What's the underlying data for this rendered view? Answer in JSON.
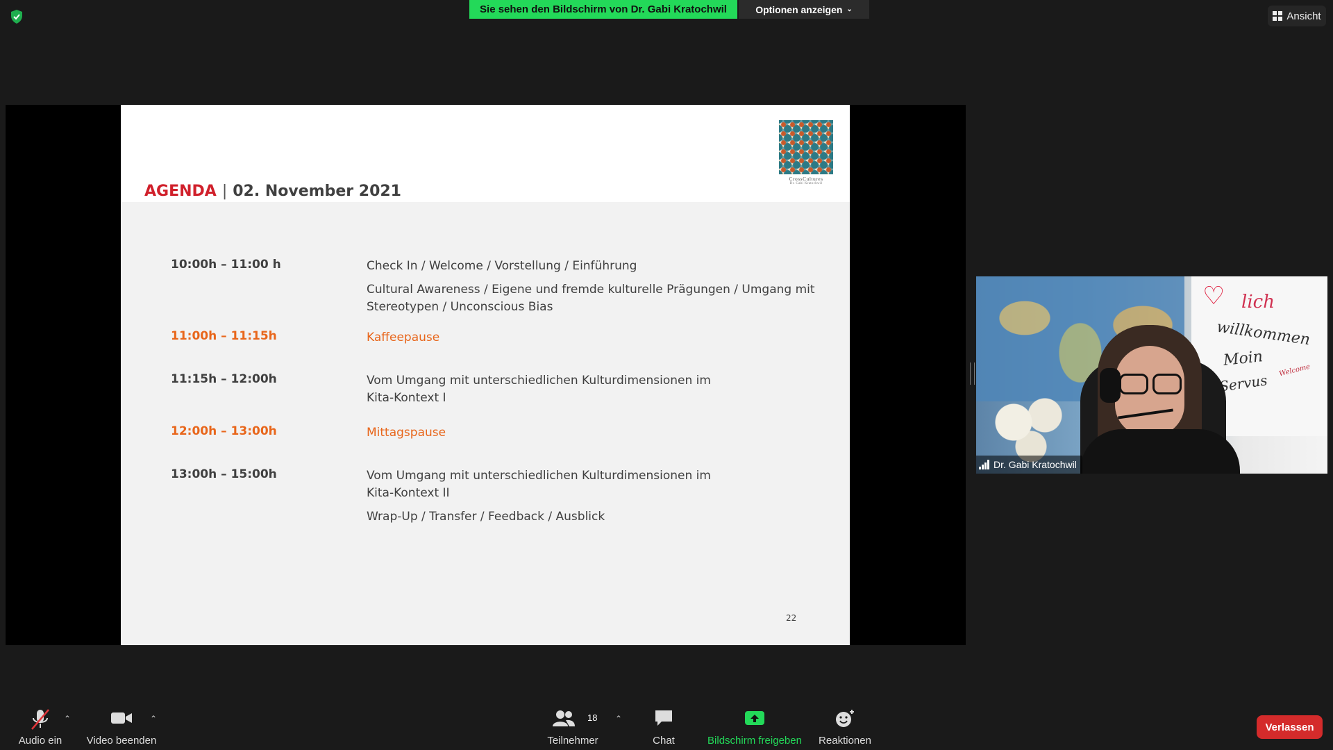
{
  "top_bar": {
    "share_banner": "Sie sehen den Bildschirm von Dr. Gabi Kratochwil",
    "options_label": "Optionen anzeigen",
    "view_label": "Ansicht"
  },
  "slide": {
    "title_accent": "AGENDA",
    "title_separator": "|",
    "title_date": "02. November 2021",
    "logo_line1": "CrossCultures",
    "logo_line2": "Dr. Gabi Kratochwil",
    "page_number": "22",
    "agenda": [
      {
        "time": "10:00h – 11:00 h",
        "items": [
          "Check In / Welcome / Vorstellung / Einführung",
          "Cultural Awareness / Eigene und fremde kulturelle Prägungen / Umgang mit Stereotypen / Unconscious Bias"
        ],
        "highlight": false
      },
      {
        "time": "11:00h – 11:15h",
        "items": [
          "Kaffeepause"
        ],
        "highlight": true
      },
      {
        "time": "11:15h – 12:00h",
        "items": [
          "Vom Umgang mit unterschiedlichen Kulturdimensionen im Kita-Kontext I"
        ],
        "highlight": false
      },
      {
        "time": "12:00h – 13:00h",
        "items": [
          "Mittagspause"
        ],
        "highlight": true
      },
      {
        "time": "13:00h – 15:00h",
        "items": [
          "Vom Umgang mit unterschiedlichen Kulturdimensionen im Kita-Kontext II",
          "Wrap-Up / Transfer / Feedback / Ausblick"
        ],
        "highlight": false
      }
    ]
  },
  "video": {
    "participant_name": "Dr. Gabi Kratochwil",
    "board_words": [
      "lich",
      "willkommen",
      "Moin",
      "Servus",
      "Welcome"
    ]
  },
  "toolbar": {
    "audio_label": "Audio ein",
    "video_label": "Video beenden",
    "participants_label": "Teilnehmer",
    "participants_count": "18",
    "chat_label": "Chat",
    "share_label": "Bildschirm freigeben",
    "reactions_label": "Reaktionen",
    "leave_label": "Verlassen"
  },
  "colors": {
    "accent_green": "#23d959",
    "slide_red": "#d0202b",
    "slide_orange": "#e8661b",
    "leave_red": "#d42b2b"
  }
}
